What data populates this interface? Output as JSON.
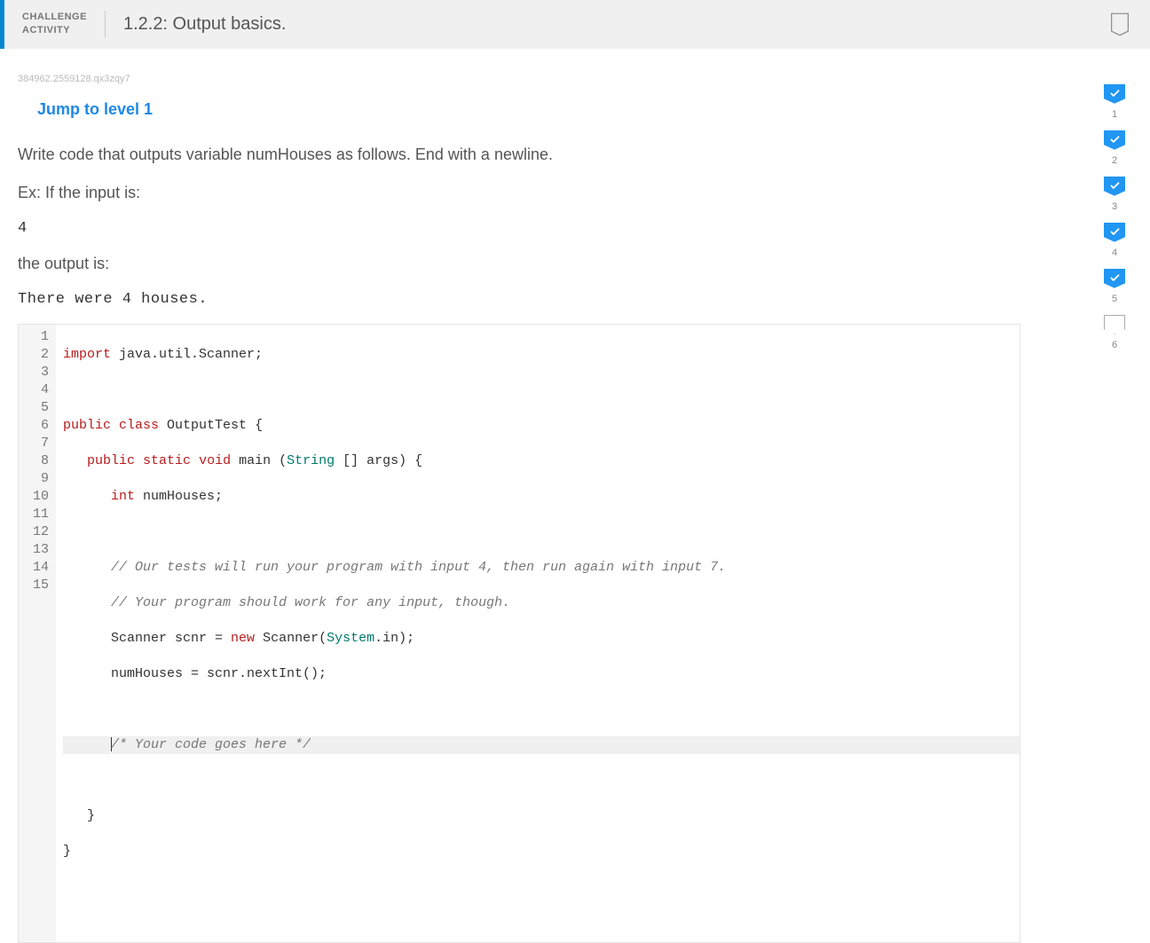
{
  "header": {
    "label_line1": "CHALLENGE",
    "label_line2": "ACTIVITY",
    "title": "1.2.2: Output basics."
  },
  "tracking_id": "384962.2559128.qx3zqy7",
  "jump_link": "Jump to level 1",
  "prompt": {
    "line1": "Write code that outputs variable numHouses as follows. End with a newline.",
    "line2": "Ex: If the input is:",
    "example_input": "4",
    "line3": "the output is:",
    "example_output": "There were 4 houses."
  },
  "levels": [
    {
      "n": "1",
      "done": true
    },
    {
      "n": "2",
      "done": true
    },
    {
      "n": "3",
      "done": true
    },
    {
      "n": "4",
      "done": true
    },
    {
      "n": "5",
      "done": true
    },
    {
      "n": "6",
      "done": false
    }
  ],
  "code": {
    "lines": [
      "1",
      "2",
      "3",
      "4",
      "5",
      "6",
      "7",
      "8",
      "9",
      "10",
      "11",
      "12",
      "13",
      "14",
      "15"
    ],
    "l1_kw": "import",
    "l1_rest": " java.util.Scanner;",
    "l3_kw1": "public",
    "l3_kw2": "class",
    "l3_name": " OutputTest ",
    "l3_brace": "{",
    "l4_kw1": "public",
    "l4_kw2": "static",
    "l4_kw3": "void",
    "l4_name": " main ",
    "l4_paren1": "(",
    "l4_type": "String",
    "l4_args": " [] args) {",
    "l5_kw": "int",
    "l5_rest": " numHouses;",
    "l7_cm": "// Our tests will run your program with input 4, then run again with input 7.",
    "l8_cm": "// Your program should work for any input, though.",
    "l9_a": "Scanner scnr = ",
    "l9_kw": "new",
    "l9_b": " Scanner(",
    "l9_type": "System",
    "l9_c": ".in);",
    "l10_txt": "numHouses = scnr.nextInt();",
    "l12_cm": "/* Your code goes here */",
    "l14_txt": "}",
    "l15_txt": "}"
  }
}
